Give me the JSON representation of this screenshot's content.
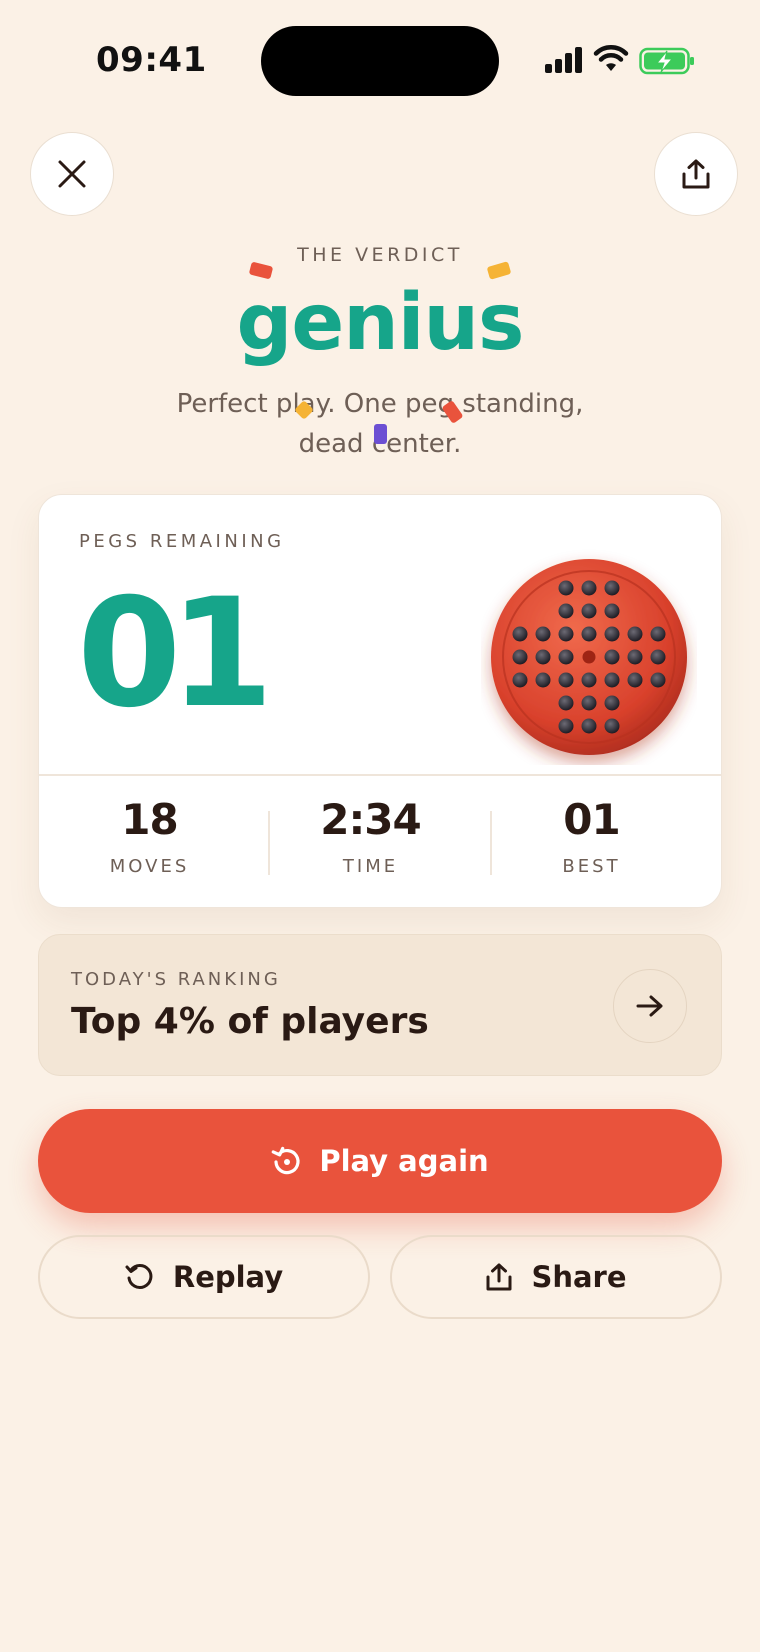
{
  "status_bar": {
    "time": "09:41"
  },
  "header": {
    "close_icon": "close-icon",
    "share_icon": "share-icon"
  },
  "verdict": {
    "eyebrow": "THE VERDICT",
    "word": "genius",
    "subtitle": "Perfect play. One peg standing, dead center.",
    "accent_color": "#16A58A"
  },
  "result_card": {
    "pegs_label": "PEGS REMAINING",
    "pegs_value": "01",
    "stats": [
      {
        "value": "18",
        "label": "MOVES"
      },
      {
        "value": "2:34",
        "label": "TIME"
      },
      {
        "value": "01",
        "label": "BEST"
      }
    ]
  },
  "ranking": {
    "label": "TODAY'S RANKING",
    "value": "Top 4% of players",
    "arrow_icon": "arrow-right-icon"
  },
  "actions": {
    "play_again": "Play again",
    "replay": "Replay",
    "share": "Share"
  },
  "colors": {
    "background": "#FBF1E6",
    "primary": "#E9533C",
    "accent": "#16A58A",
    "text": "#2A1A14"
  }
}
